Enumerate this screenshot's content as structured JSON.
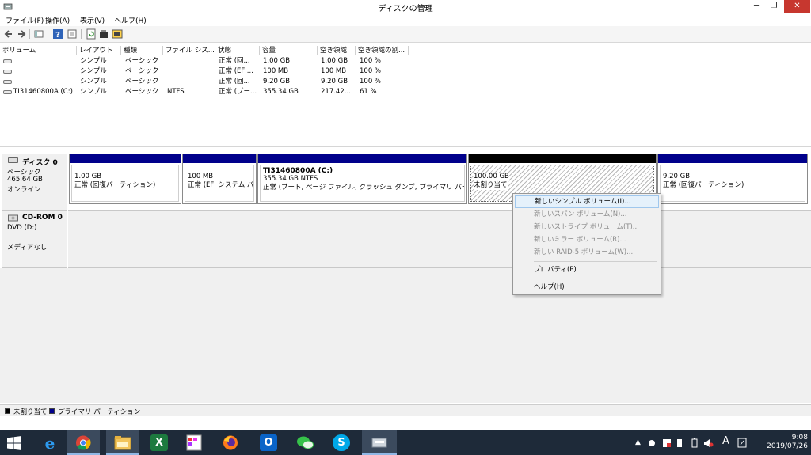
{
  "window": {
    "title": "ディスクの管理",
    "min_glyph": "─",
    "max_glyph": "❐",
    "close_glyph": "✕"
  },
  "menu": [
    "ファイル(F)",
    "操作(A)",
    "表示(V)",
    "ヘルプ(H)"
  ],
  "toolbar_icons": [
    "back-icon",
    "forward-icon",
    "view-icon",
    "help-icon",
    "properties-icon",
    "refresh-icon",
    "rescan-icon",
    "settings-icon"
  ],
  "volume_table": {
    "headers": [
      "ボリューム",
      "レイアウト",
      "種類",
      "ファイル シス...",
      "状態",
      "容量",
      "空き領域",
      "空き領域の割..."
    ],
    "rows": [
      {
        "volume": "",
        "layout": "シンプル",
        "type": "ベーシック",
        "fs": "",
        "status": "正常 (回...",
        "capacity": "1.00 GB",
        "free": "1.00 GB",
        "pct": "100 %"
      },
      {
        "volume": "",
        "layout": "シンプル",
        "type": "ベーシック",
        "fs": "",
        "status": "正常 (EFI...",
        "capacity": "100 MB",
        "free": "100 MB",
        "pct": "100 %"
      },
      {
        "volume": "",
        "layout": "シンプル",
        "type": "ベーシック",
        "fs": "",
        "status": "正常 (回...",
        "capacity": "9.20 GB",
        "free": "9.20 GB",
        "pct": "100 %"
      },
      {
        "volume": "TI31460800A (C:)",
        "layout": "シンプル",
        "type": "ベーシック",
        "fs": "NTFS",
        "status": "正常 (ブー...",
        "capacity": "355.34 GB",
        "free": "217.42...",
        "pct": "61 %"
      }
    ]
  },
  "disk0": {
    "name": "ディスク 0",
    "type": "ベーシック",
    "size": "465.64 GB",
    "state": "オンライン",
    "partitions": [
      {
        "name": "",
        "size": "1.00 GB",
        "status": "正常 (回復パーティション)"
      },
      {
        "name": "",
        "size": "100 MB",
        "status": "正常 (EFI システム パ"
      },
      {
        "name": "TI31460800A (C:)",
        "size": "355.34 GB NTFS",
        "status": "正常 (ブート, ページ ファイル, クラッシュ ダンプ, プライマリ パーティション)"
      },
      {
        "name": "",
        "size": "100.00 GB",
        "status": "未割り当て"
      },
      {
        "name": "",
        "size": "9.20 GB",
        "status": "正常 (回復パーティション)"
      }
    ]
  },
  "cdrom0": {
    "name": "CD-ROM 0",
    "drive": "DVD (D:)",
    "media": "メディアなし"
  },
  "context_menu": {
    "items": [
      {
        "label": "新しいシンプル ボリューム(I)...",
        "enabled": true
      },
      {
        "label": "新しいスパン ボリューム(N)...",
        "enabled": false
      },
      {
        "label": "新しいストライプ ボリューム(T)...",
        "enabled": false
      },
      {
        "label": "新しいミラー ボリューム(R)...",
        "enabled": false
      },
      {
        "label": "新しい RAID-5 ボリューム(W)...",
        "enabled": false
      },
      {
        "label": "プロパティ(P)",
        "enabled": true
      },
      {
        "label": "ヘルプ(H)",
        "enabled": true
      }
    ]
  },
  "legend": {
    "unallocated": "未割り当て",
    "primary": "プライマリ パーティション"
  },
  "colors": {
    "primary_bar": "#00008b",
    "unallocated_bar": "#000000",
    "taskbar": "#1e2a39"
  },
  "taskbar": {
    "apps": [
      "start-icon",
      "ie-icon",
      "chrome-icon",
      "explorer-icon",
      "excel-icon",
      "paint-icon",
      "firefox-icon",
      "outlook-icon",
      "wechat-icon",
      "skype-icon",
      "disk-management-icon"
    ],
    "ime": "A",
    "time": "9:08",
    "date": "2019/07/26"
  }
}
